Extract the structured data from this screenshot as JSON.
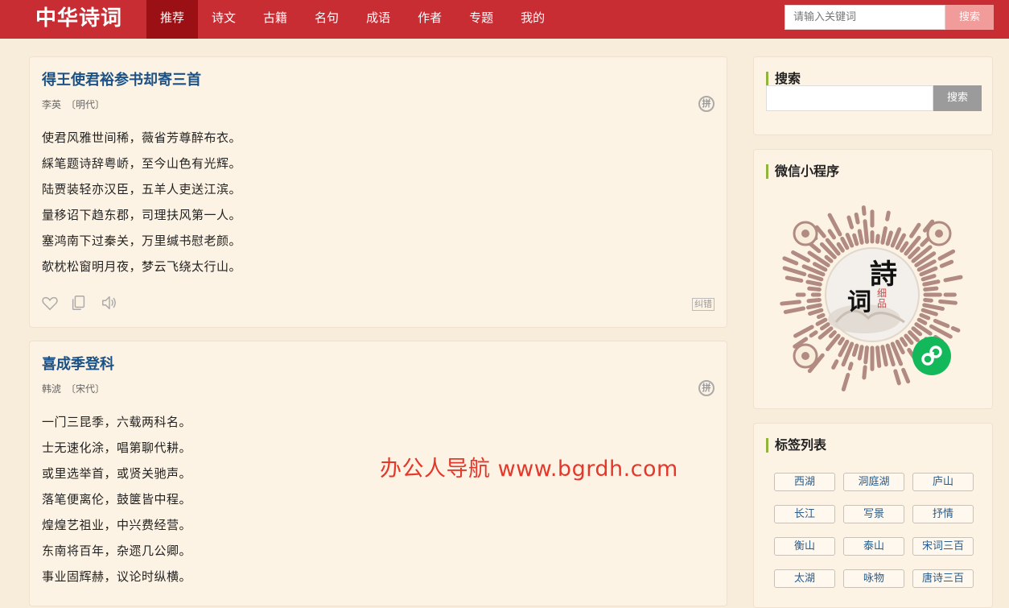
{
  "header": {
    "logo": "中华诗词",
    "nav": [
      "推荐",
      "诗文",
      "古籍",
      "名句",
      "成语",
      "作者",
      "专题",
      "我的"
    ],
    "search_placeholder": "请输入关键词",
    "search_button": "搜索"
  },
  "poems": [
    {
      "title": "得王使君裕参书却寄三首",
      "author": "李英",
      "dynasty": "〔明代〕",
      "pinyin_icon": "拼",
      "lines": [
        "使君风雅世间稀，薇省芳尊醉布衣。",
        "綵笔题诗辞粤峤，至今山色有光辉。",
        "陆贾装轻亦汉臣，五羊人吏送江滨。",
        "量移诏下趋东郡，司理扶风第一人。",
        "塞鸿南下过秦关，万里缄书慰老颜。",
        "欹枕松窗明月夜，梦云飞绕太行山。"
      ],
      "report": "纠错"
    },
    {
      "title": "喜成季登科",
      "author": "韩淲",
      "dynasty": "〔宋代〕",
      "pinyin_icon": "拼",
      "lines": [
        "一门三昆季，六载两科名。",
        "士无速化涂，唱第聊代耕。",
        "或里选举首，或贤关驰声。",
        "落笔便离伦，鼓箧皆中程。",
        "煌煌艺祖业，中兴费经营。",
        "东南将百年，杂遝几公卿。",
        "事业固辉赫，议论时纵横。"
      ]
    }
  ],
  "sidebar": {
    "search": {
      "title": "搜索",
      "button": "搜索"
    },
    "miniprogram": {
      "title": "微信小程序",
      "qr_text": [
        "詩",
        "词"
      ],
      "qr_sub": "细品"
    },
    "tags": {
      "title": "标签列表",
      "items": [
        "西湖",
        "洞庭湖",
        "庐山",
        "长江",
        "写景",
        "抒情",
        "衡山",
        "泰山",
        "宋词三百",
        "太湖",
        "咏物",
        "唐诗三百"
      ]
    }
  },
  "watermark": "办公人导航 www.bgrdh.com",
  "colors": {
    "header": "#c82d34",
    "active_nav": "#9b1014",
    "title": "#1c5186",
    "accent": "#93b43c"
  }
}
